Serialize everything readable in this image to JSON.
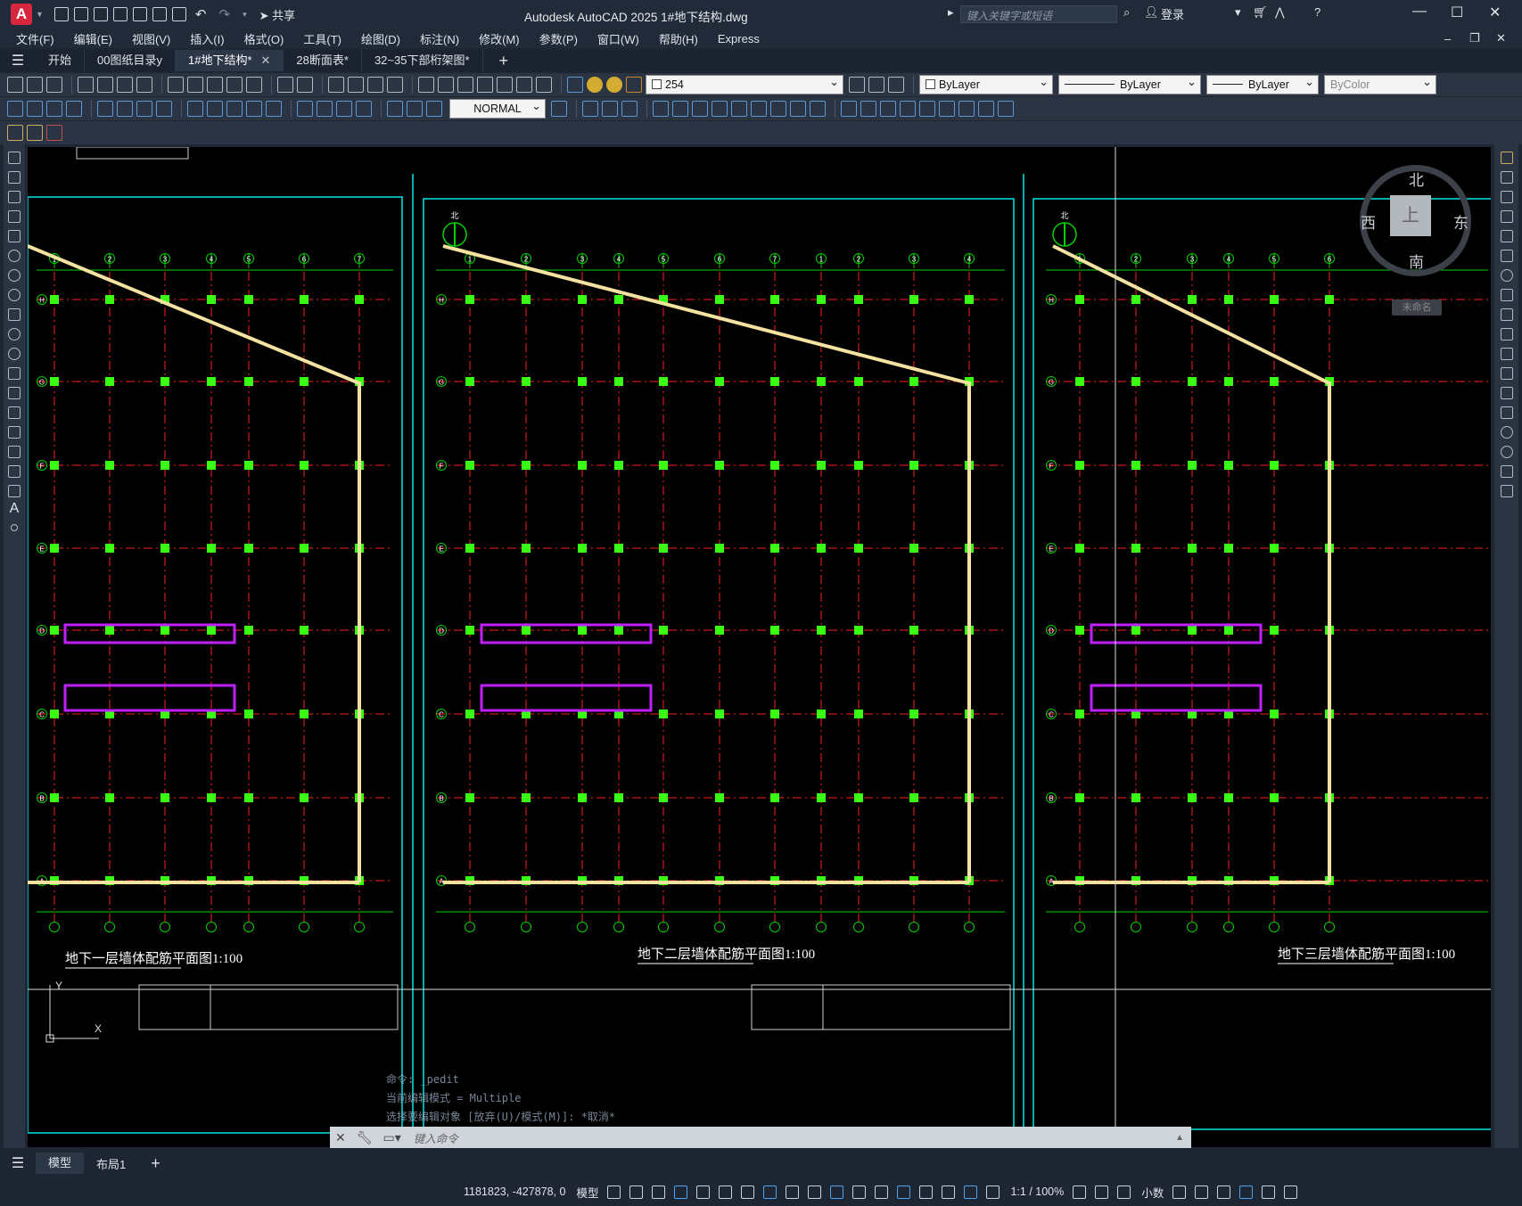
{
  "app": {
    "logo": "A",
    "share_label": "共享",
    "title": "Autodesk AutoCAD 2025    1#地下结构.dwg",
    "search_placeholder": "键入关键字或短语",
    "login_label": "登录"
  },
  "menu": [
    "文件(F)",
    "编辑(E)",
    "视图(V)",
    "插入(I)",
    "格式(O)",
    "工具(T)",
    "绘图(D)",
    "标注(N)",
    "修改(M)",
    "参数(P)",
    "窗口(W)",
    "帮助(H)",
    "Express"
  ],
  "tabs": [
    {
      "label": "开始",
      "active": false
    },
    {
      "label": "00图纸目录y",
      "active": false
    },
    {
      "label": "1#地下结构*",
      "active": true
    },
    {
      "label": "28断面表*",
      "active": false
    },
    {
      "label": "32~35下部桁架图*",
      "active": false
    }
  ],
  "toolbar": {
    "layer_value": "254",
    "color_value": "ByLayer",
    "linetype_value": "ByLayer",
    "lineweight_value": "ByLayer",
    "plotstyle_value": "ByColor",
    "dimstyle_value": "NORMAL"
  },
  "viewcube": {
    "north": "北",
    "south": "南",
    "west": "西",
    "east": "东",
    "top": "上",
    "wcs": "未命名"
  },
  "drawing": {
    "plan1_title": "地下一层墙体配筋平面图",
    "plan2_title": "地下二层墙体配筋平面图",
    "plan3_title": "地下三层墙体配筋平面图",
    "scale": "1:100",
    "north_mark": "北",
    "grid_letters": [
      "H",
      "G",
      "F",
      "E",
      "D",
      "C",
      "B",
      "A"
    ],
    "grid_numbers": [
      "1",
      "2",
      "3",
      "4",
      "5",
      "6",
      "7"
    ],
    "axis_x": "X",
    "axis_y": "Y"
  },
  "command": {
    "history": [
      "命令: _pedit",
      "当前编辑模式 = Multiple",
      "选择要编辑对象 [放弃(U)/模式(M)]: *取消*"
    ],
    "prompt": "键入命令"
  },
  "layout_tabs": [
    {
      "label": "模型",
      "active": true
    },
    {
      "label": "布局1",
      "active": false
    }
  ],
  "status": {
    "coords": "1181823, -427878, 0",
    "model_label": "模型",
    "scale_label": "1:1 / 100%",
    "units_label": "小数"
  },
  "colors": {
    "frame": "#00e5e5",
    "grid_red": "#ff2020",
    "grid_green": "#00d000",
    "column_green": "#39ff14",
    "wall_yellow": "#f4e2a0",
    "beam_magenta": "#c020ff"
  }
}
